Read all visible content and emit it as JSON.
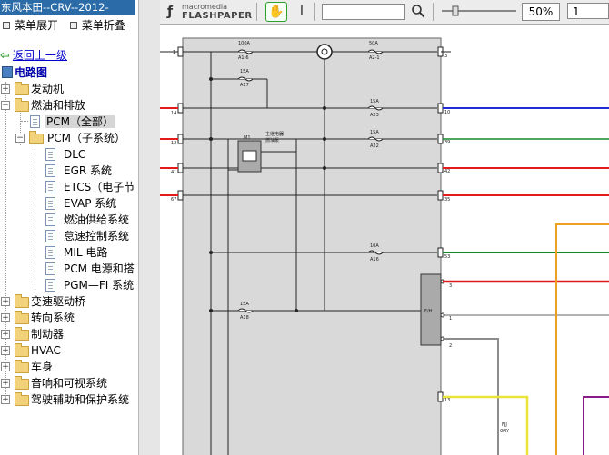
{
  "app_title": "东风本田--CRV--2012-",
  "menu": {
    "expand": "菜单展开",
    "collapse": "菜单折叠"
  },
  "back_link": "返回上一级",
  "tree": {
    "root": "电路图",
    "engine": "发动机",
    "fuel": "燃油和排放",
    "pcm_all": "PCM（全部）",
    "pcm_sub": "PCM（子系统）",
    "sub_items": [
      "DLC",
      "EGR 系统",
      "ETCS（电子节",
      "EVAP 系统",
      "燃油供给系统",
      "怠速控制系统",
      "MIL 电路",
      "PCM 电源和搭",
      "PGM—FI 系统"
    ],
    "transmission": "变速驱动桥",
    "steering": "转向系统",
    "brakes": "制动器",
    "hvac": "HVAC",
    "body": "车身",
    "audio": "音响和可视系统",
    "driver_assist": "驾驶辅助和保护系统"
  },
  "toolbar": {
    "logo_top": "macromedia",
    "logo_bottom": "FLASHPAPER",
    "zoom": "50%",
    "page": "1"
  },
  "diagram": {
    "fuses": [
      "100A",
      "15A",
      "50A",
      "15A",
      "15A",
      "10A",
      "15A"
    ],
    "fuse_ids": [
      "A1-6",
      "A17",
      "A2-1",
      "A23",
      "A22",
      "A16",
      "A18"
    ],
    "relay_label": "主继电器",
    "relay_label2": "燃油泵",
    "relay_id": "M1",
    "connector_label": "F/H",
    "bottom_wire_label": "FJJ",
    "bottom_wire_label2": "GRY",
    "pin_left": [
      "1",
      "14",
      "12",
      "41",
      "67"
    ],
    "pin_right": [
      "3",
      "10",
      "39",
      "42",
      "35",
      "53",
      "13",
      "3",
      "1",
      "2"
    ],
    "colors": {
      "red": "#e31b1b",
      "blue": "#1e2bd6",
      "green": "#16882a",
      "orange": "#f0a020",
      "yellow": "#e8e43a",
      "purple": "#8a1a8a",
      "gray": "#8c8c8c"
    }
  }
}
